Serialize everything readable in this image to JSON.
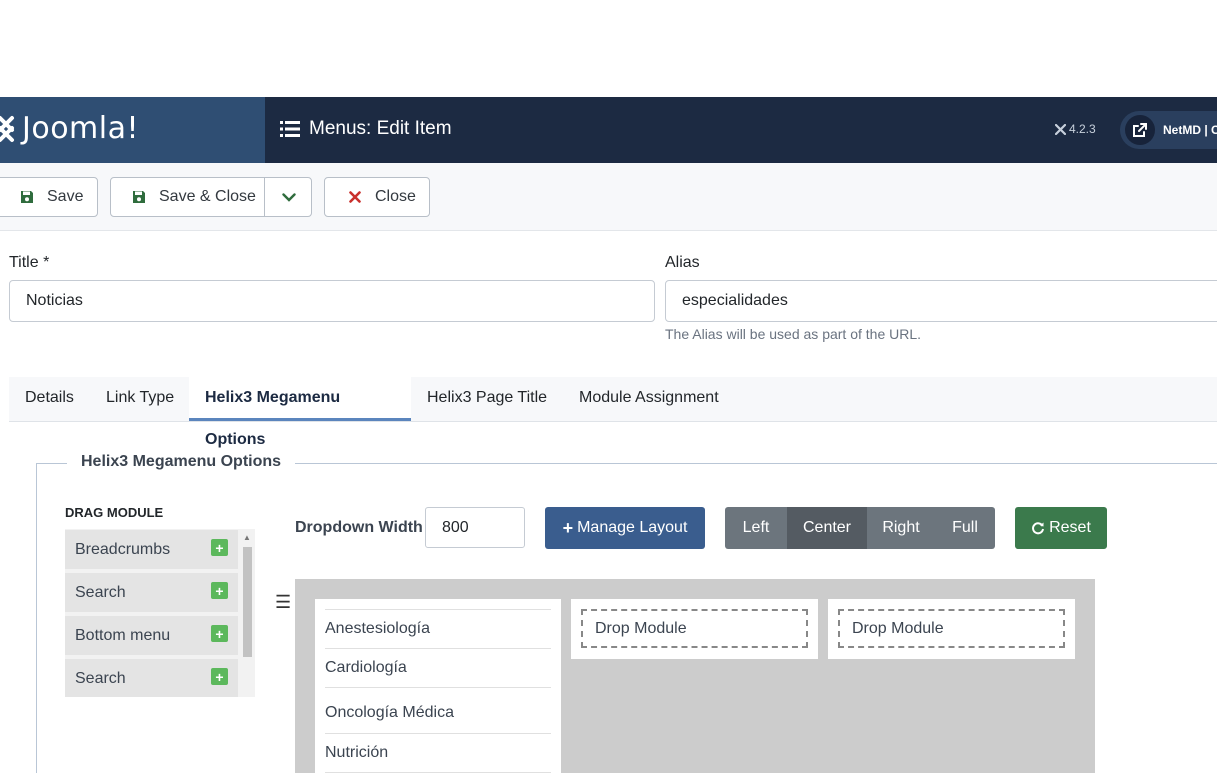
{
  "header": {
    "logo_text": "Joomla!",
    "page_title": "Menus: Edit Item",
    "version": "4.2.3",
    "user_name": "NetMD | Co",
    "colors": {
      "header_bg": "#1c2a42",
      "logo_bg": "#2f4e73"
    }
  },
  "toolbar": {
    "save_label": "Save",
    "save_close_label": "Save & Close",
    "close_label": "Close"
  },
  "form": {
    "title_label": "Title *",
    "title_value": "Noticias",
    "alias_label": "Alias",
    "alias_value": "especialidades",
    "alias_help": "The Alias will be used as part of the URL."
  },
  "tabs": [
    {
      "label": "Details"
    },
    {
      "label": "Link Type"
    },
    {
      "label": "Helix3 Megamenu Options",
      "active": true
    },
    {
      "label": "Helix3 Page Title"
    },
    {
      "label": "Module Assignment"
    }
  ],
  "megamenu": {
    "legend": "Helix3 Megamenu Options",
    "drag_module_title": "DRAG MODULE",
    "modules": [
      "Breadcrumbs",
      "Search",
      "Bottom menu",
      "Search"
    ],
    "dropdown_width_label": "Dropdown Width",
    "dropdown_width_value": "800",
    "manage_layout_label": "Manage Layout",
    "alignment_options": [
      "Left",
      "Center",
      "Right",
      "Full"
    ],
    "selected_alignment": "Center",
    "reset_label": "Reset",
    "column1_items": [
      "Anestesiología",
      "Cardiología",
      "Oncología Médica",
      "Nutrición"
    ],
    "drop_module_label": "Drop Module"
  }
}
